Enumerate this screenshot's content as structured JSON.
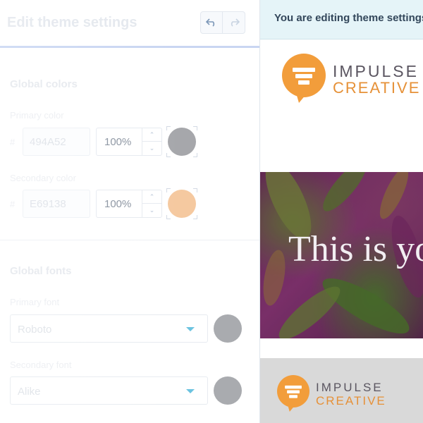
{
  "editor": {
    "title": "Edit theme settings",
    "undo_icon": "undo-icon",
    "redo_icon": "redo-icon",
    "global_colors": {
      "heading": "Global colors",
      "primary": {
        "label": "Primary color",
        "hash": "#",
        "hex": "494A52",
        "opacity": "100%",
        "swatch": "#a6a7ab"
      },
      "secondary": {
        "label": "Secondary color",
        "hash": "#",
        "hex": "E69138",
        "opacity": "100%",
        "swatch": "#f5c9a0"
      }
    },
    "global_fonts": {
      "heading": "Global fonts",
      "primary": {
        "label": "Primary font",
        "value": "Roboto"
      },
      "secondary": {
        "label": "Secondary font",
        "value": "Alike"
      }
    }
  },
  "preview": {
    "banner": "You are editing theme settings",
    "logo": {
      "line1": "IMPULSE",
      "line2": "CREATIVE"
    },
    "hero_text": "This is yo",
    "footer_logo": {
      "line1": "IMPULSE",
      "line2": "CREATIVE"
    },
    "colors": {
      "accent": "#e69138",
      "text": "#494a52"
    }
  }
}
